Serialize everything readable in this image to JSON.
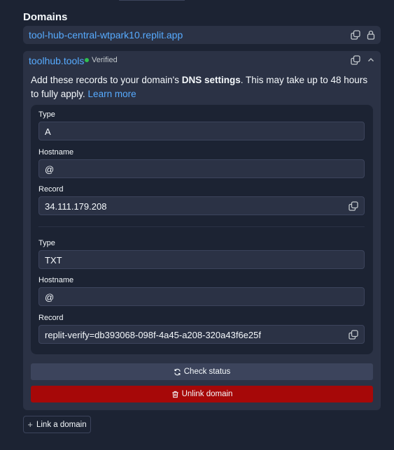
{
  "section_title": "Domains",
  "dev_domain": {
    "url": "tool-hub-central-wtpark10.replit.app",
    "icons": [
      "copy-icon",
      "lock-icon"
    ]
  },
  "custom_domain": {
    "name": "toolhub.tools",
    "status": "Verified",
    "status_color": "#2fbf4f",
    "description_prefix": "Add these records to your domain's ",
    "description_bold": "DNS settings",
    "description_suffix": ". This may take up to 48 hours to fully apply. ",
    "learn_more": "Learn more",
    "records": [
      {
        "type_label": "Type",
        "type_value": "A",
        "hostname_label": "Hostname",
        "hostname_value": "@",
        "record_label": "Record",
        "record_value": "34.111.179.208"
      },
      {
        "type_label": "Type",
        "type_value": "TXT",
        "hostname_label": "Hostname",
        "hostname_value": "@",
        "record_label": "Record",
        "record_value": "replit-verify=db393068-098f-4a45-a208-320a43f6e25f"
      }
    ],
    "check_status_label": "Check status",
    "unlink_label": "Unlink domain"
  },
  "link_domain_label": "Link a domain",
  "colors": {
    "background": "#1c2333",
    "surface": "#2b3245",
    "link": "#57abff",
    "danger": "#a60808"
  }
}
